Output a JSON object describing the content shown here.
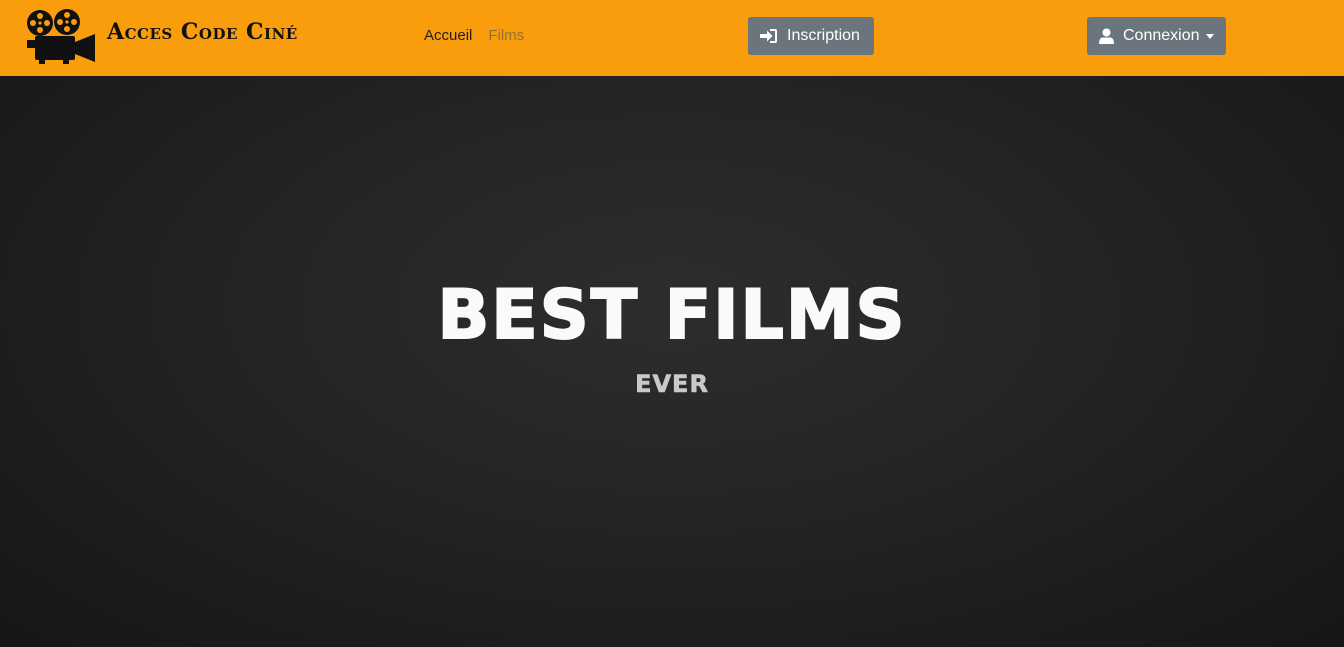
{
  "navbar": {
    "brand": {
      "logo_icon": "film-camera-icon",
      "name": "Acces Code Ciné"
    },
    "links": [
      {
        "label": "Accueil",
        "active": true
      },
      {
        "label": "Films",
        "active": false
      }
    ],
    "inscription": {
      "label": "Inscription",
      "icon": "sign-in-icon"
    },
    "connexion": {
      "label": "Connexion",
      "icon": "user-icon",
      "dropdown_icon": "caret-down-icon"
    }
  },
  "hero": {
    "title": "BEST FILMS",
    "subtitle": "EVER"
  },
  "colors": {
    "navbar_bg": "#fa9d0c",
    "button_bg": "#6c757d",
    "hero_bg": "#252525",
    "title": "#fafafa",
    "subtitle": "#c9c9c9"
  }
}
